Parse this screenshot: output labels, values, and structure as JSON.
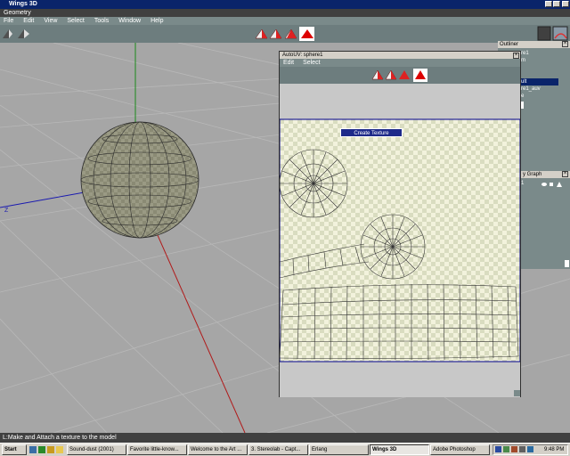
{
  "window": {
    "title": "Wings 3D"
  },
  "mode_bar": {
    "label": "Geometry"
  },
  "menu": [
    "File",
    "Edit",
    "View",
    "Select",
    "Tools",
    "Window",
    "Help"
  ],
  "viewport": {
    "axis_label": "Z"
  },
  "outliner": {
    "title": "Outliner",
    "items": [
      "re1",
      "m",
      "",
      "",
      "ult",
      "re1_auv",
      "e"
    ],
    "selected_index": 4
  },
  "geometry_graph": {
    "title": "y Graph",
    "items": [
      "1"
    ]
  },
  "autouv": {
    "title": "AutoUV: sphere1",
    "menu": [
      "Edit",
      "Select"
    ],
    "create_texture_label": "Create Texture"
  },
  "status": {
    "text": "L:Make and Attach a texture to the model"
  },
  "taskbar": {
    "start_label": "Start",
    "tasks": [
      {
        "label": "Sound-dust (2001)",
        "active": false
      },
      {
        "label": "Favorite little-know...",
        "active": false
      },
      {
        "label": "Welcome to the Art ...",
        "active": false
      },
      {
        "label": "3. Stereolab - Capt...",
        "active": false
      },
      {
        "label": "Erlang",
        "active": false
      },
      {
        "label": "Wings 3D",
        "active": true
      },
      {
        "label": "Adobe Photoshop",
        "active": false
      }
    ],
    "clock": "9:48 PM"
  },
  "colors": {
    "title_bg": "#0a246a",
    "panel_bg": "#7a8a8a",
    "viewport_bg": "#a6a6a6",
    "selection": "#0a246a",
    "mode_active": "#cc0000"
  }
}
